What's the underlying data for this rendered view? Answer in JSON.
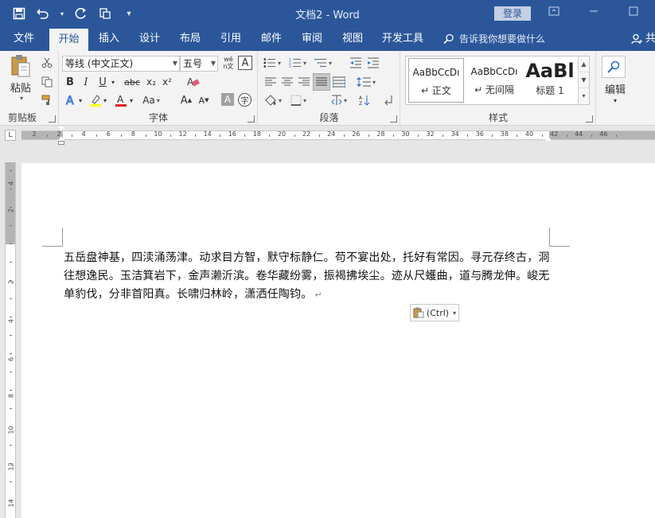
{
  "window": {
    "title": "文档2 - Word",
    "login_label": "登录"
  },
  "tabs": [
    {
      "label": "文件"
    },
    {
      "label": "开始"
    },
    {
      "label": "插入"
    },
    {
      "label": "设计"
    },
    {
      "label": "布局"
    },
    {
      "label": "引用"
    },
    {
      "label": "邮件"
    },
    {
      "label": "审阅"
    },
    {
      "label": "视图"
    },
    {
      "label": "开发工具"
    }
  ],
  "tell_me": "告诉我你想要做什么",
  "share_label": "共",
  "clipboard": {
    "paste_label": "粘贴",
    "group_label": "剪贴板"
  },
  "font": {
    "font_name": "等线 (中文正文)",
    "font_size": "五号",
    "wen_label": "wén文",
    "group_label": "字体",
    "bold": "B",
    "italic": "I",
    "underline": "U",
    "strike": "abc",
    "subscript": "x₂",
    "superscript": "x²",
    "change_case": "Aa",
    "grow": "A",
    "shrink": "A",
    "char_shade": "A",
    "phonetic": "字"
  },
  "paragraph": {
    "group_label": "段落"
  },
  "styles": {
    "group_label": "样式",
    "items": [
      {
        "sample": "AaBbCcDı",
        "name": "↵ 正文"
      },
      {
        "sample": "AaBbCcDı",
        "name": "↵ 无间隔"
      },
      {
        "sample": "AaBl",
        "name": "标题 1"
      }
    ]
  },
  "editing": {
    "label": "编辑"
  },
  "ruler": {
    "numbers": [
      "2",
      "2",
      "4",
      "6",
      "8",
      "10",
      "12",
      "14",
      "16",
      "18",
      "20",
      "22",
      "24",
      "26",
      "28",
      "30",
      "32",
      "34",
      "36",
      "38",
      "40",
      "42",
      "44",
      "46"
    ],
    "vertical_numbers": [
      "4",
      "2",
      "2",
      "4",
      "6",
      "8",
      "10",
      "12",
      "14"
    ]
  },
  "document": {
    "paragraph": "五岳盘神基，四渎涌荡津。动求目方智，默守标静仁。苟不宴出处，托好有常因。寻元存终古，洞往想逸民。玉洁箕岩下，金声濑沂滨。卷华藏纷雾，振褐拂埃尘。迹从尺蠖曲，道与腾龙伸。峻无单豹伐，分非首阳真。长啸归林岭，潇洒任陶钧。",
    "paste_options": "(Ctrl)"
  }
}
